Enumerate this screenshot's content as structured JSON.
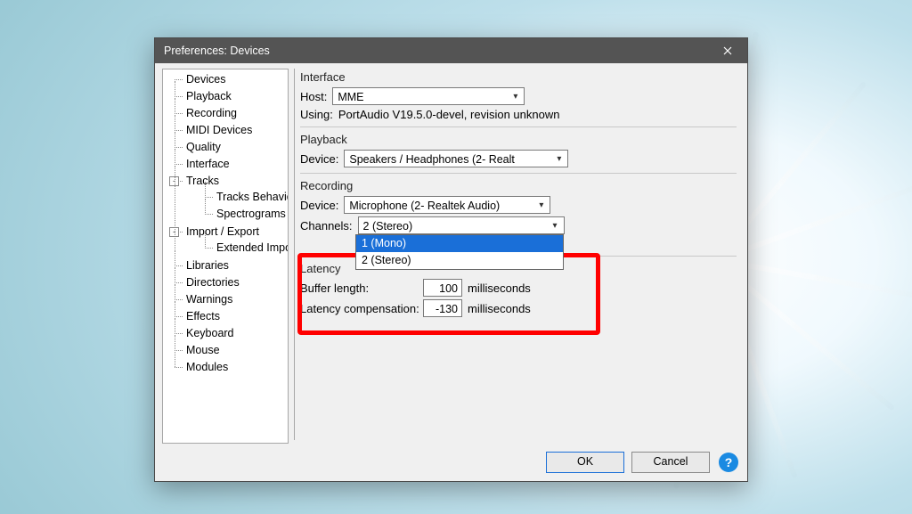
{
  "window": {
    "title": "Preferences: Devices"
  },
  "sidebar": {
    "items": [
      {
        "label": "Devices",
        "selected": true
      },
      {
        "label": "Playback"
      },
      {
        "label": "Recording"
      },
      {
        "label": "MIDI Devices"
      },
      {
        "label": "Quality"
      },
      {
        "label": "Interface"
      },
      {
        "label": "Tracks",
        "expand": "-",
        "children": [
          {
            "label": "Tracks Behaviors"
          },
          {
            "label": "Spectrograms"
          }
        ]
      },
      {
        "label": "Import / Export",
        "expand": "-",
        "children": [
          {
            "label": "Extended Import"
          }
        ]
      },
      {
        "label": "Libraries"
      },
      {
        "label": "Directories"
      },
      {
        "label": "Warnings"
      },
      {
        "label": "Effects"
      },
      {
        "label": "Keyboard"
      },
      {
        "label": "Mouse"
      },
      {
        "label": "Modules"
      }
    ]
  },
  "interface": {
    "title": "Interface",
    "host_label": "Host:",
    "host_value": "MME",
    "using_label": "Using:",
    "using_value": "PortAudio V19.5.0-devel, revision unknown"
  },
  "playback": {
    "title": "Playback",
    "device_label": "Device:",
    "device_value": "Speakers / Headphones (2- Realt"
  },
  "recording": {
    "title": "Recording",
    "device_label": "Device:",
    "device_value": "Microphone (2- Realtek Audio)",
    "channels_label": "Channels:",
    "channels_value": "2 (Stereo)",
    "channels_options": [
      "1 (Mono)",
      "2 (Stereo)"
    ],
    "channels_highlight_index": 0
  },
  "latency": {
    "title": "Latency",
    "buffer_label": "Buffer length:",
    "buffer_value": "100",
    "buffer_units": "milliseconds",
    "comp_label": "Latency compensation:",
    "comp_value": "-130",
    "comp_units": "milliseconds"
  },
  "footer": {
    "ok": "OK",
    "cancel": "Cancel",
    "help": "?"
  }
}
